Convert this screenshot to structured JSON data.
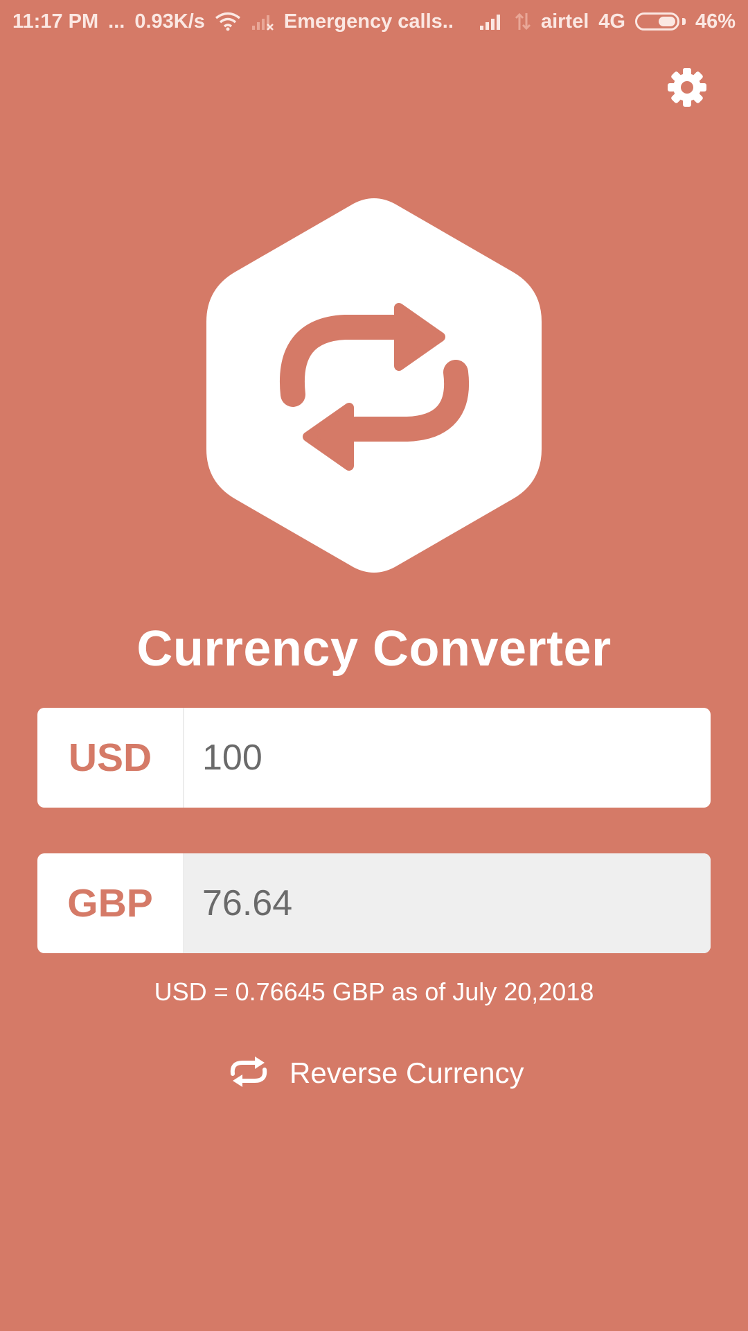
{
  "status_bar": {
    "time": "11:17 PM",
    "dots": "...",
    "speed": "0.93K/s",
    "emergency": "Emergency calls..",
    "carrier": "airtel",
    "network": "4G",
    "battery_percent": "46%",
    "battery_level": 0.46
  },
  "header": {
    "settings_icon": "gear-icon"
  },
  "logo": {
    "icon": "exchange-arrows-icon"
  },
  "app": {
    "title": "Currency Converter"
  },
  "converter": {
    "from": {
      "code": "USD",
      "amount": "100"
    },
    "to": {
      "code": "GBP",
      "amount": "76.64"
    },
    "rate_text": "USD = 0.76645 GBP as of July 20,2018"
  },
  "actions": {
    "reverse_label": "Reverse Currency",
    "reverse_icon": "repeat-icon"
  },
  "colors": {
    "background": "#d57a67",
    "accent": "#d57a67",
    "input_bg": "#ffffff",
    "output_bg": "#efefef"
  }
}
